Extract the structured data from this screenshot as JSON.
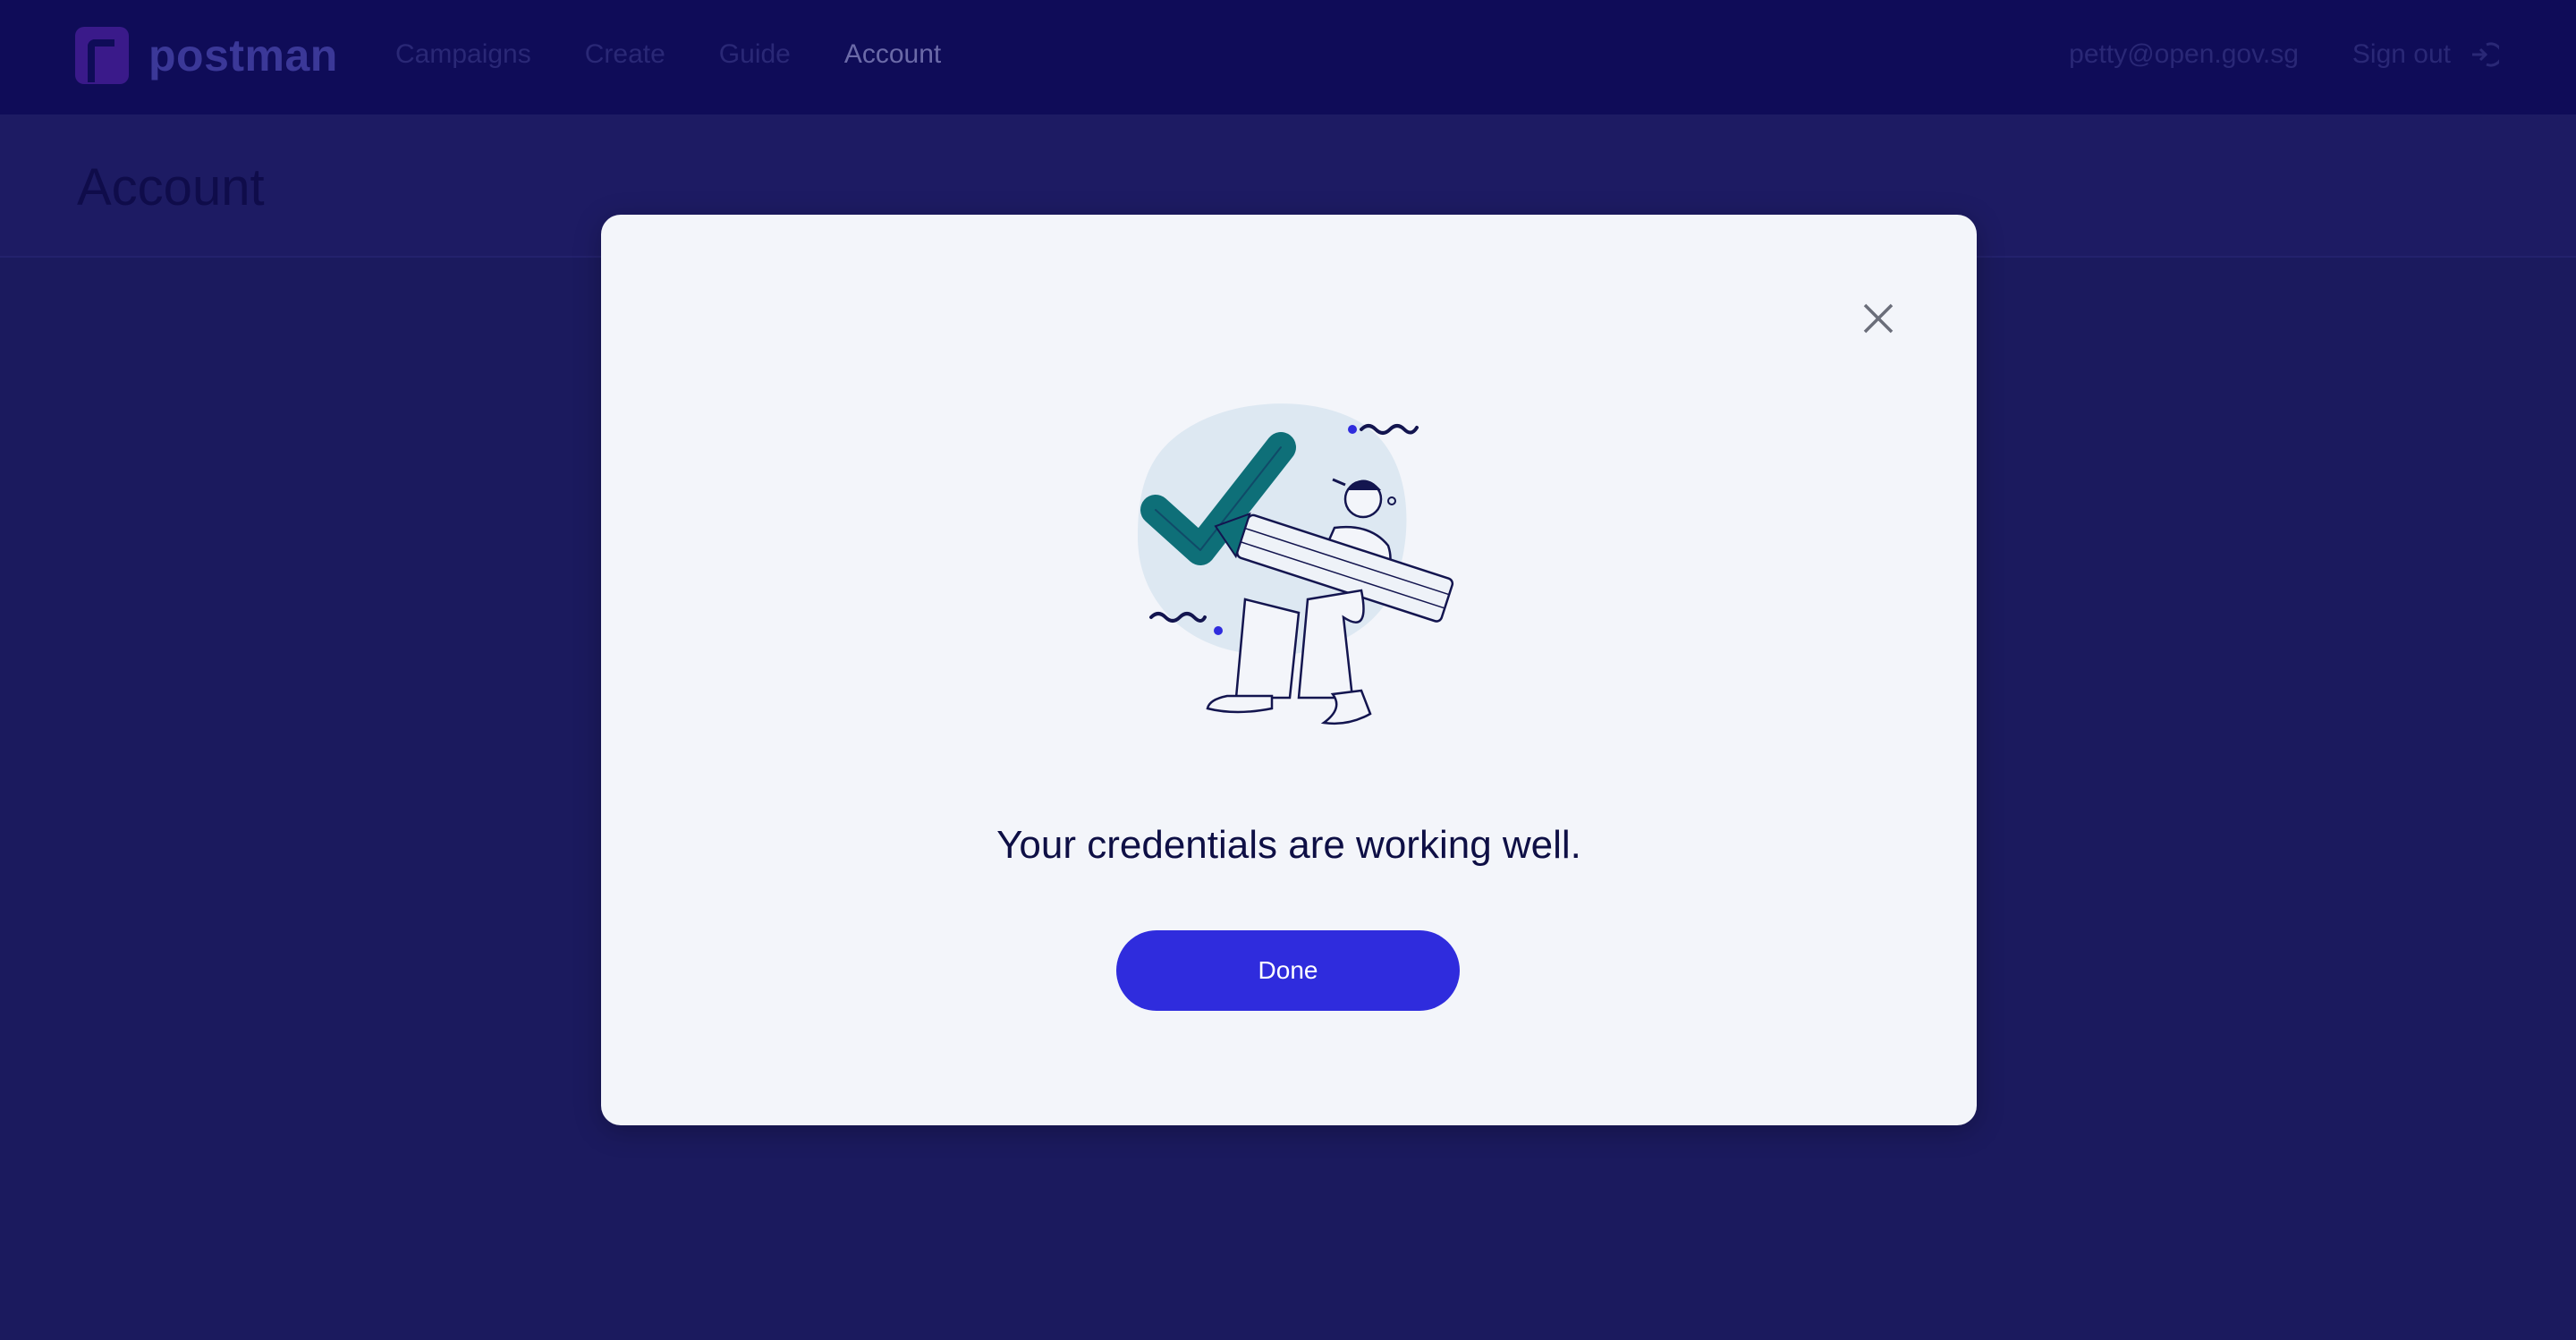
{
  "navbar": {
    "logo_text": "postman",
    "links": [
      {
        "label": "Campaigns"
      },
      {
        "label": "Create"
      },
      {
        "label": "Guide"
      },
      {
        "label": "Account"
      }
    ],
    "user_email": "petty@open.gov.sg",
    "signout_label": "Sign out"
  },
  "page": {
    "title": "Account"
  },
  "modal": {
    "message": "Your credentials are working well.",
    "done_label": "Done",
    "illustration_icon": "success-checkmark-person-icon"
  },
  "colors": {
    "navbar_bg": "#0f0c58",
    "page_bg": "#1b1a5e",
    "modal_bg": "#f3f5fa",
    "primary_button": "#2f2cdd",
    "message_text": "#0e0f45",
    "checkmark": "#0e6f78"
  }
}
